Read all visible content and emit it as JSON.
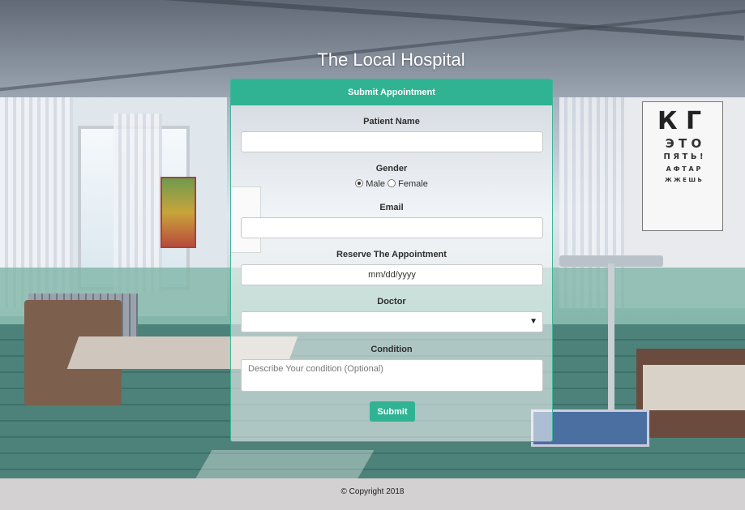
{
  "header": {
    "title": "The Local Hospital"
  },
  "form": {
    "heading": "Submit Appointment",
    "patient_name_label": "Patient Name",
    "patient_name_value": "",
    "gender_label": "Gender",
    "gender_options": [
      "Male",
      "Female"
    ],
    "gender_selected": "Male",
    "email_label": "Email",
    "email_value": "",
    "date_label": "Reserve The Appointment",
    "date_placeholder": "mm/dd/yyyy",
    "doctor_label": "Doctor",
    "doctor_selected": "",
    "condition_label": "Condition",
    "condition_placeholder": "Describe Your condition (Optional)",
    "submit_label": "Submit"
  },
  "footer": {
    "copyright": "© Copyright 2018"
  },
  "colors": {
    "accent": "#2fb393",
    "footer_bg": "#d3d1d1"
  },
  "background": {
    "eye_chart_rows": [
      "К Г",
      "Э Т О",
      "П Я Т Ь !",
      "А Ф Т А Р",
      "Ж Ж Е Ш Ь"
    ]
  }
}
